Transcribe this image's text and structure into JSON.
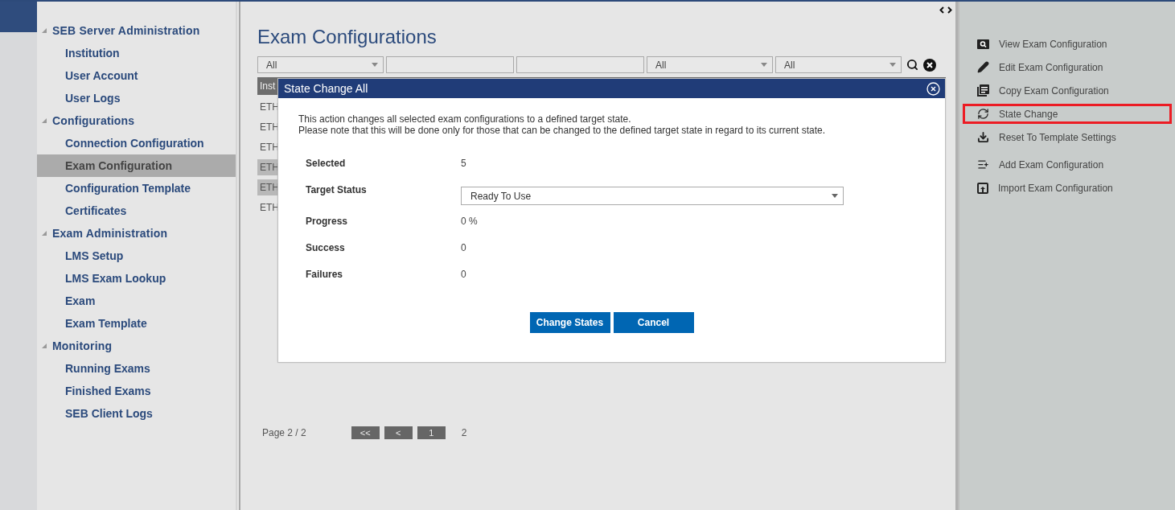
{
  "navigation": [
    {
      "label": "SEB Server Administration",
      "expanded": true,
      "children": [
        {
          "label": "Institution",
          "selected": false
        },
        {
          "label": "User Account",
          "selected": false
        },
        {
          "label": "User Logs",
          "selected": false
        }
      ]
    },
    {
      "label": "Configurations",
      "expanded": true,
      "children": [
        {
          "label": "Connection Configuration",
          "selected": false
        },
        {
          "label": "Exam Configuration",
          "selected": true
        },
        {
          "label": "Configuration Template",
          "selected": false
        },
        {
          "label": "Certificates",
          "selected": false
        }
      ]
    },
    {
      "label": "Exam Administration",
      "expanded": true,
      "children": [
        {
          "label": "LMS Setup",
          "selected": false
        },
        {
          "label": "LMS Exam Lookup",
          "selected": false
        },
        {
          "label": "Exam",
          "selected": false
        },
        {
          "label": "Exam Template",
          "selected": false
        }
      ]
    },
    {
      "label": "Monitoring",
      "expanded": true,
      "children": [
        {
          "label": "Running Exams",
          "selected": false
        },
        {
          "label": "Finished Exams",
          "selected": false
        },
        {
          "label": "SEB Client Logs",
          "selected": false
        }
      ]
    }
  ],
  "page_title": "Exam Configurations",
  "filters": [
    {
      "kind": "select",
      "value": "All"
    },
    {
      "kind": "text"
    },
    {
      "kind": "text"
    },
    {
      "kind": "select",
      "value": "All"
    },
    {
      "kind": "select",
      "value": "All"
    }
  ],
  "table": {
    "header": "Inst",
    "rows": [
      {
        "cell": "ETH",
        "selected": false
      },
      {
        "cell": "ETH",
        "selected": false
      },
      {
        "cell": "ETH",
        "selected": false
      },
      {
        "cell": "ETH",
        "selected": true
      },
      {
        "cell": "ETH",
        "selected": true
      },
      {
        "cell": "ETH",
        "selected": false
      }
    ]
  },
  "pager": {
    "label": "Page 2 / 2",
    "buttons": [
      "<<",
      "<",
      "1"
    ],
    "current": "2"
  },
  "dialog": {
    "title": "State Change All",
    "description": "This action changes all selected exam configurations to a defined target state.\nPlease note that this will be done only for those that can be changed to the defined target state in regard to its current state.",
    "fields": [
      {
        "kind": "text",
        "label": "Selected",
        "value": "5"
      },
      {
        "kind": "select",
        "label": "Target Status",
        "value": "Ready To Use"
      },
      {
        "kind": "text",
        "label": "Progress",
        "value": "0 %"
      },
      {
        "kind": "text",
        "label": "Success",
        "value": "0"
      },
      {
        "kind": "text",
        "label": "Failures",
        "value": "0"
      }
    ],
    "buttons": [
      "Change States",
      "Cancel"
    ]
  },
  "actions": [
    {
      "kind": "view",
      "label": "View Exam Configuration",
      "highlighted": false
    },
    {
      "kind": "edit",
      "label": "Edit Exam Configuration",
      "highlighted": false
    },
    {
      "kind": "copy",
      "label": "Copy Exam Configuration",
      "highlighted": false
    },
    {
      "kind": "state",
      "label": "State Change",
      "highlighted": true
    },
    {
      "kind": "reset",
      "label": "Reset To Template Settings",
      "highlighted": false
    },
    {
      "kind": "add",
      "label": "Add Exam Configuration",
      "highlighted": false
    },
    {
      "kind": "import",
      "label": "Import Exam Configuration",
      "highlighted": false
    }
  ]
}
